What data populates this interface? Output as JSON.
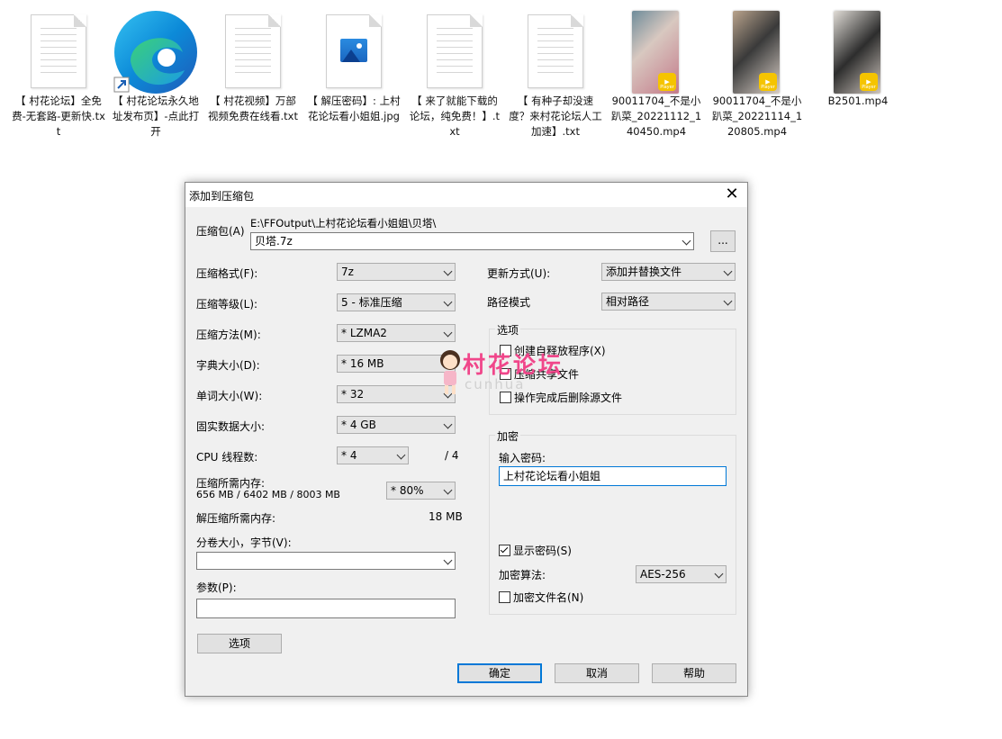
{
  "desktop": [
    {
      "kind": "txt",
      "label": "【 村花论坛】全免费-无套路-更新快.txt"
    },
    {
      "kind": "edge",
      "label": "【 村花论坛永久地址发布页】-点此打开"
    },
    {
      "kind": "txt",
      "label": "【 村花视频】万部视频免费在线看.txt"
    },
    {
      "kind": "jpg",
      "label": "【 解压密码】: 上村花论坛看小姐姐.jpg"
    },
    {
      "kind": "txt",
      "label": "【 来了就能下载的论坛，纯免费！】.txt"
    },
    {
      "kind": "txt",
      "label": "【 有种子却没速度？来村花论坛人工加速】.txt"
    },
    {
      "kind": "video",
      "label": "90011704_不是小趴菜_20221112_140450.mp4",
      "player": "Player"
    },
    {
      "kind": "video",
      "label": "90011704_不是小趴菜_20221114_120805.mp4",
      "player": "Player"
    },
    {
      "kind": "video",
      "label": "B2501.mp4",
      "player": "Player"
    }
  ],
  "dialog": {
    "title": "添加到压缩包",
    "archive_label": "压缩包(A)",
    "archive_path": "E:\\FFOutput\\上村花论坛看小姐姐\\贝塔\\",
    "archive_name": "贝塔.7z",
    "browse": "...",
    "left": {
      "format_label": "压缩格式(F):",
      "format": "7z",
      "level_label": "压缩等级(L):",
      "level": "5 - 标准压缩",
      "method_label": "压缩方法(M):",
      "method": "* LZMA2",
      "dict_label": "字典大小(D):",
      "dict": "* 16 MB",
      "word_label": "单词大小(W):",
      "word": "* 32",
      "solid_label": "固实数据大小:",
      "solid": "* 4 GB",
      "cpu_label": "CPU 线程数:",
      "cpu": "* 4",
      "cpu_max": "/ 4",
      "mem_label": "压缩所需内存:",
      "mem_value": "656 MB / 6402 MB / 8003 MB",
      "mem_pct": "* 80%",
      "decomp_label": "解压缩所需内存:",
      "decomp_value": "18 MB",
      "split_label": "分卷大小，字节(V):",
      "split": "",
      "params_label": "参数(P):",
      "params": "",
      "options_button": "选项"
    },
    "right": {
      "update_label": "更新方式(U):",
      "update": "添加并替换文件",
      "path_label": "路径模式",
      "path": "相对路径",
      "options_group": "选项",
      "sfx": "创建自释放程序(X)",
      "shared": "压缩共享文件",
      "delete_after": "操作完成后删除源文件",
      "encrypt_group": "加密",
      "password_label": "输入密码:",
      "password": "上村花论坛看小姐姐",
      "show_password": "显示密码(S)",
      "algo_label": "加密算法:",
      "algo": "AES-256",
      "encrypt_names": "加密文件名(N)"
    },
    "buttons": {
      "ok": "确定",
      "cancel": "取消",
      "help": "帮助"
    }
  },
  "watermark": {
    "text": "村花论坛",
    "sub": "cunhua"
  }
}
